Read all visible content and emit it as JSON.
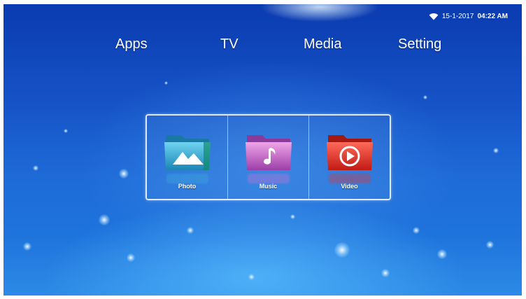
{
  "status_bar": {
    "date": "15-1-2017",
    "time": "04:22 AM",
    "wifi_icon": "wifi-icon"
  },
  "nav": {
    "items": [
      {
        "label": "Apps"
      },
      {
        "label": "TV"
      },
      {
        "label": "Media"
      },
      {
        "label": "Setting"
      }
    ]
  },
  "media_tiles": [
    {
      "label": "Photo",
      "icon": "photo-folder-icon",
      "color": "#3fb0d8"
    },
    {
      "label": "Music",
      "icon": "music-folder-icon",
      "color": "#d36fd0"
    },
    {
      "label": "Video",
      "icon": "video-folder-icon",
      "color": "#e8322a"
    }
  ]
}
